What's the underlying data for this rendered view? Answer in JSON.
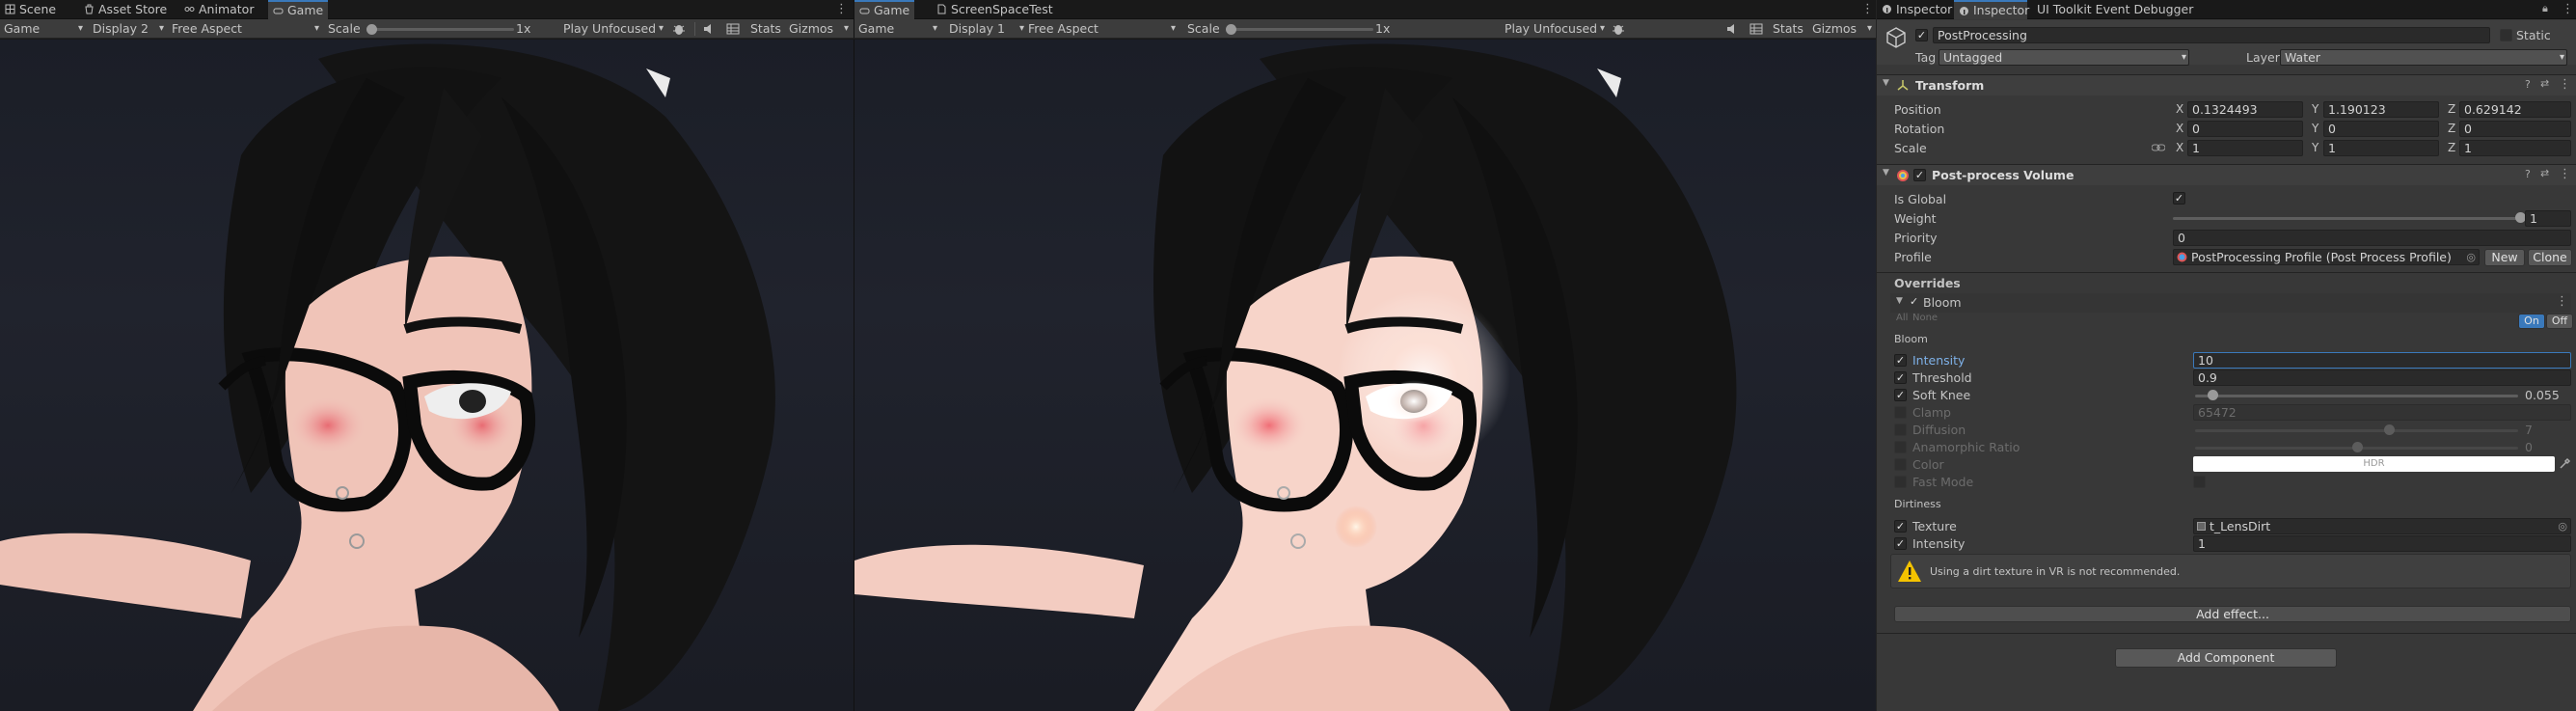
{
  "left_pane": {
    "tabs": [
      {
        "label": "Scene"
      },
      {
        "label": "Asset Store"
      },
      {
        "label": "Animator"
      },
      {
        "label": "Game"
      }
    ],
    "toolbar": {
      "view": "Game",
      "display": "Display 2",
      "aspect": "Free Aspect",
      "scale_label": "Scale",
      "scale_value": "1x",
      "play_mode": "Play Unfocused",
      "stats": "Stats",
      "gizmos": "Gizmos"
    }
  },
  "mid_pane": {
    "tabs": [
      {
        "label": "Game"
      },
      {
        "label": "ScreenSpaceTest"
      }
    ],
    "toolbar": {
      "view": "Game",
      "display": "Display 1",
      "aspect": "Free Aspect",
      "scale_label": "Scale",
      "scale_value": "1x",
      "play_mode": "Play Unfocused",
      "stats": "Stats",
      "gizmos": "Gizmos"
    }
  },
  "inspector": {
    "tabs": [
      {
        "label": "Inspector"
      },
      {
        "label": "Inspector"
      },
      {
        "label": "UI Toolkit Event Debugger"
      }
    ],
    "object": {
      "name": "PostProcessing",
      "static_label": "Static",
      "tag_label": "Tag",
      "tag": "Untagged",
      "layer_label": "Layer",
      "layer": "Water"
    },
    "transform": {
      "title": "Transform",
      "position": {
        "label": "Position",
        "x": "0.1324493",
        "y": "1.190123",
        "z": "0.629142"
      },
      "rotation": {
        "label": "Rotation",
        "x": "0",
        "y": "0",
        "z": "0"
      },
      "scale": {
        "label": "Scale",
        "x": "1",
        "y": "1",
        "z": "1"
      }
    },
    "volume": {
      "title": "Post-process Volume",
      "is_global_label": "Is Global",
      "weight_label": "Weight",
      "weight_value": "1",
      "weight_fraction": 1.0,
      "priority_label": "Priority",
      "priority_value": "0",
      "profile_label": "Profile",
      "profile_value": "PostProcessing Profile (Post Process Profile)",
      "new_button": "New",
      "clone_button": "Clone"
    },
    "overrides": {
      "title": "Overrides",
      "effect": "Bloom",
      "all": "All",
      "none": "None",
      "on": "On",
      "off": "Off",
      "bloom_section": "Bloom",
      "intensity_label": "Intensity",
      "intensity_value": "10",
      "threshold_label": "Threshold",
      "threshold_value": "0.9",
      "soft_knee_label": "Soft Knee",
      "soft_knee_value": "0.055",
      "soft_knee_fraction": 0.055,
      "clamp_label": "Clamp",
      "clamp_value": "65472",
      "diffusion_label": "Diffusion",
      "diffusion_value": "7",
      "diffusion_fraction": 0.6,
      "anamorphic_label": "Anamorphic Ratio",
      "anamorphic_value": "0",
      "anamorphic_fraction": 0.5,
      "color_label": "Color",
      "color_value": "HDR",
      "color_hex": "#ffffff",
      "fast_mode_label": "Fast Mode",
      "dirtiness_section": "Dirtiness",
      "texture_label": "Texture",
      "texture_value": "t_LensDirt",
      "dirt_intensity_label": "Intensity",
      "dirt_intensity_value": "1",
      "warning": "Using a dirt texture in VR is not recommended.",
      "add_effect": "Add effect..."
    },
    "add_component": "Add Component"
  }
}
